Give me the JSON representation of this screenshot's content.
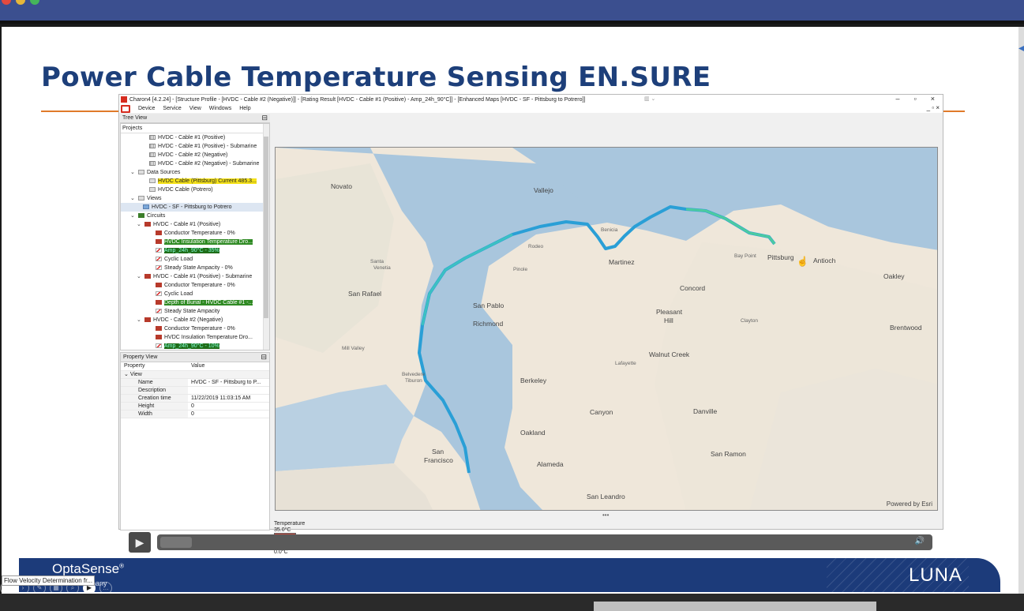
{
  "slide": {
    "title": "Power Cable Temperature Sensing EN.SURE"
  },
  "app": {
    "window_title": "Charon4 [4.2.24] - [Structure Profile - [HVDC - Cable #2 (Negative)]] - [Rating Result [HVDC - Cable #1 (Positive) - Amp_24h_90°C]] - [Enhanced Maps [HVDC - SF - Pittsburg to Potrero]]",
    "menu": [
      "Device",
      "Service",
      "View",
      "Windows",
      "Help"
    ],
    "window_controls": [
      "–",
      "▫",
      "×"
    ],
    "mdi_controls": "_ ▫ ×"
  },
  "tree_view": {
    "title": "Tree View",
    "header": "Projects",
    "rows": [
      {
        "text": "HVDC - Cable #1 (Positive)",
        "indent": 4,
        "icon": "cable-icon",
        "hl": ""
      },
      {
        "text": "HVDC - Cable #1 (Positive) - Submarine",
        "indent": 4,
        "icon": "cable-icon",
        "hl": ""
      },
      {
        "text": "HVDC - Cable #2 (Negative)",
        "indent": 4,
        "icon": "cable-icon",
        "hl": ""
      },
      {
        "text": "HVDC - Cable #2 (Negative) - Submarine",
        "indent": 4,
        "icon": "cable-icon",
        "hl": ""
      },
      {
        "text": "Data Sources",
        "indent": 1,
        "icon": "folder-icon",
        "hl": "",
        "chev": "⌄"
      },
      {
        "text": "HVDC Cable (Pittsburg) Current 485.3...",
        "indent": 4,
        "icon": "data-icon",
        "hl": "yellow"
      },
      {
        "text": "HVDC Cable (Potrero)",
        "indent": 4,
        "icon": "data-icon",
        "hl": ""
      },
      {
        "text": "Views",
        "indent": 1,
        "icon": "views-icon",
        "hl": "",
        "chev": "⌄"
      },
      {
        "text": "HVDC - SF - Pittsburg to Potrero",
        "indent": 3,
        "icon": "map-icon",
        "hl": "sel"
      },
      {
        "text": "Circuits",
        "indent": 1,
        "icon": "circuit-icon",
        "hl": "",
        "chev": "⌄"
      },
      {
        "text": "HVDC - Cable #1 (Positive)",
        "indent": 2,
        "icon": "cable-red-icon",
        "hl": "",
        "chev": "⌄"
      },
      {
        "text": "Conductor Temperature - 0%",
        "indent": 5,
        "icon": "calc-icon",
        "hl": ""
      },
      {
        "text": "HVDC Insulation Temperature Dro...",
        "indent": 5,
        "icon": "calc-icon",
        "hl": "green"
      },
      {
        "text": "Amp_24h_90°C - 35%",
        "indent": 5,
        "icon": "rating-icon",
        "hl": "green2"
      },
      {
        "text": "Cyclic Load",
        "indent": 5,
        "icon": "rating-icon",
        "hl": ""
      },
      {
        "text": "Steady State Ampacity - 0%",
        "indent": 5,
        "icon": "rating-icon",
        "hl": ""
      },
      {
        "text": "HVDC - Cable #1 (Positive) - Submarine",
        "indent": 2,
        "icon": "cable-red-icon",
        "hl": "",
        "chev": "⌄"
      },
      {
        "text": "Conductor Temperature - 0%",
        "indent": 5,
        "icon": "calc-icon",
        "hl": ""
      },
      {
        "text": "Cyclic Load",
        "indent": 5,
        "icon": "rating-icon",
        "hl": ""
      },
      {
        "text": "Depth of Burial - HVDC Cable #1 -...",
        "indent": 5,
        "icon": "calc-icon",
        "hl": "green"
      },
      {
        "text": "Steady State Ampacity",
        "indent": 5,
        "icon": "rating-icon",
        "hl": ""
      },
      {
        "text": "HVDC - Cable #2 (Negative)",
        "indent": 2,
        "icon": "cable-red-icon",
        "hl": "",
        "chev": "⌄"
      },
      {
        "text": "Conductor Temperature - 0%",
        "indent": 5,
        "icon": "calc-icon",
        "hl": ""
      },
      {
        "text": "HVDC Insulation Temperature Dro...",
        "indent": 5,
        "icon": "calc-icon",
        "hl": ""
      },
      {
        "text": "Amp_24h_90°C - 10%",
        "indent": 5,
        "icon": "rating-icon",
        "hl": "green2"
      }
    ]
  },
  "property_view": {
    "title": "Property View",
    "col_property": "Property",
    "col_value": "Value",
    "group": "View",
    "rows": [
      {
        "k": "Name",
        "v": "HVDC - SF - Pittsburg to P..."
      },
      {
        "k": "Description",
        "v": ""
      },
      {
        "k": "Creation time",
        "v": "11/22/2019 11:03:15 AM"
      },
      {
        "k": "Height",
        "v": "0"
      },
      {
        "k": "Width",
        "v": "0"
      }
    ]
  },
  "map": {
    "powered_by": "Powered by Esri",
    "labels_big": [
      "Novato",
      "Vallejo",
      "San Rafael",
      "San Pablo",
      "Richmond",
      "Martinez",
      "Concord",
      "Pleasant Hill",
      "Walnut Creek",
      "Berkeley",
      "Oakland",
      "Alameda",
      "San Francisco",
      "Canyon",
      "Danville",
      "San Ramon",
      "San Leandro",
      "Oakley",
      "Antioch",
      "Pittsburg",
      "Brentwood"
    ],
    "labels_small": [
      "Santa Venetia",
      "Pinole",
      "Rodeo",
      "Benicia",
      "Bay Point",
      "Clayton",
      "Lafayette",
      "Mill Valley",
      "Belvedere Tiburon"
    ],
    "expand_handle": "•••"
  },
  "legend": {
    "title": "Temperature",
    "max": "35.0°C",
    "min": "0.0°C"
  },
  "player": {
    "play": "▶",
    "volume": "🔊"
  },
  "footer": {
    "brand": "OptaSense",
    "brand_mark": "®",
    "company_fragment": "pany",
    "luna": "LUNA",
    "tooltip": "Flow Velocity Determination fr..."
  },
  "colors": {
    "slide_title": "#1d3f7a",
    "rule": "#e07a2a",
    "footer": "#1c3b7a",
    "route": "#3fa9d8",
    "water": "#a9c6dd",
    "land": "#efe7da"
  }
}
